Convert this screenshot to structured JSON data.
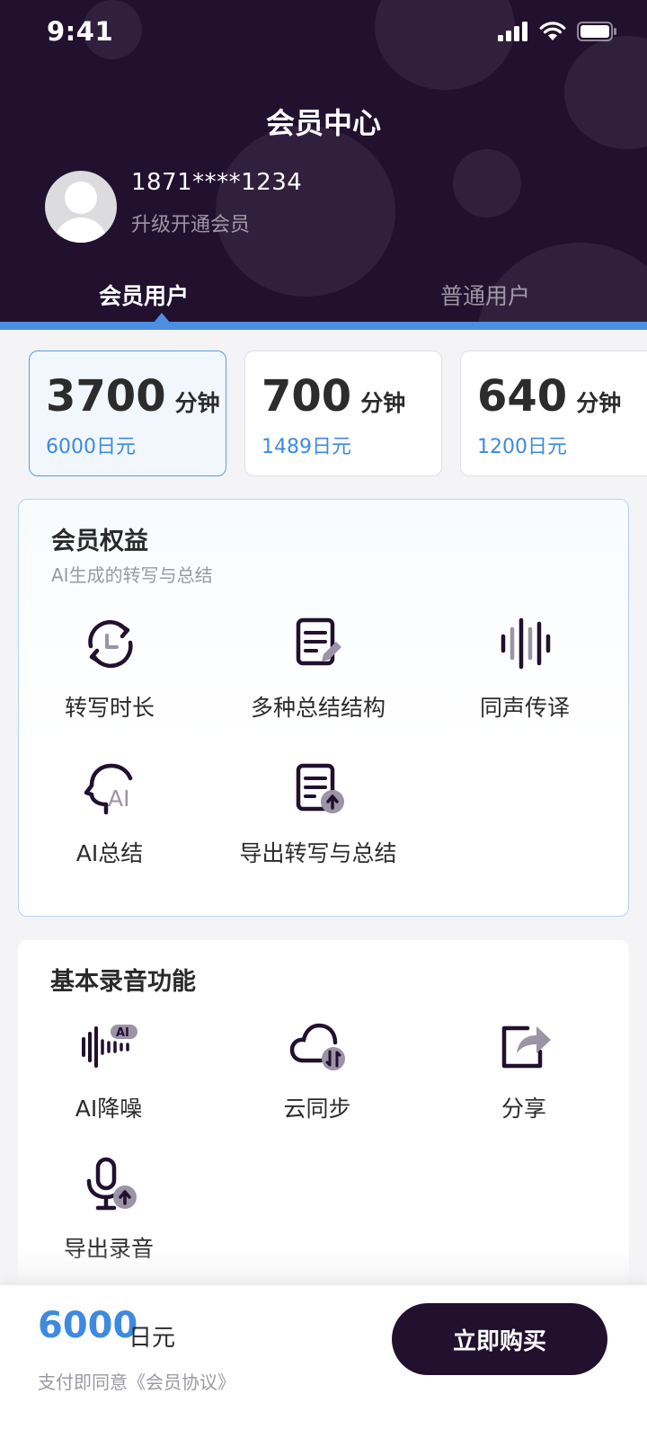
{
  "status_bar": {
    "time": "9:41"
  },
  "header": {
    "title": "会员中心",
    "user": {
      "phone": "1871****1234",
      "subtitle": "升级开通会员"
    },
    "tabs": [
      {
        "label": "会员用户",
        "active": true
      },
      {
        "label": "普通用户",
        "active": false
      }
    ]
  },
  "plans": [
    {
      "minutes": "3700",
      "unit": "分钟",
      "price": "6000日元",
      "selected": true
    },
    {
      "minutes": "700",
      "unit": "分钟",
      "price": "1489日元",
      "selected": false
    },
    {
      "minutes": "640",
      "unit": "分钟",
      "price": "1200日元",
      "selected": false
    }
  ],
  "benefits": {
    "title": "会员权益",
    "subtitle": "AI生成的转写与总结",
    "items": [
      {
        "label": "转写时长",
        "icon": "clock-refresh-icon"
      },
      {
        "label": "多种总结结构",
        "icon": "document-edit-icon"
      },
      {
        "label": "同声传译",
        "icon": "soundwave-icon"
      },
      {
        "label": "AI总结",
        "icon": "ai-head-icon"
      },
      {
        "label": "导出转写与总结",
        "icon": "document-export-icon"
      }
    ]
  },
  "basic": {
    "title": "基本录音功能",
    "items": [
      {
        "label": "AI降噪",
        "icon": "ai-noise-reduction-icon",
        "badge": "AI"
      },
      {
        "label": "云同步",
        "icon": "cloud-sync-icon"
      },
      {
        "label": "分享",
        "icon": "share-icon"
      },
      {
        "label": "导出录音",
        "icon": "microphone-export-icon"
      }
    ]
  },
  "footer": {
    "price": "6000",
    "unit": "日元",
    "agreement": "支付即同意《会员协议》",
    "buy_label": "立即购买"
  },
  "colors": {
    "header_bg": "#22102f",
    "accent_blue": "#3e8ae0",
    "icon_dark": "#22102f",
    "icon_grey": "#9b93a6"
  }
}
